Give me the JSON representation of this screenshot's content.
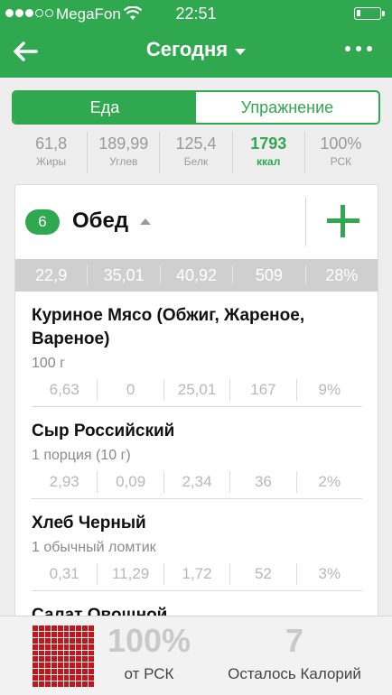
{
  "status": {
    "carrier": "MegaFon",
    "time": "22:51",
    "signal_bars_filled": 3,
    "signal_bars_total": 5
  },
  "nav": {
    "title": "Сегодня"
  },
  "tabs": [
    {
      "label": "Еда",
      "active": true
    },
    {
      "label": "Упражнение",
      "active": false
    }
  ],
  "summary": [
    {
      "value": "61,8",
      "label": "Жиры"
    },
    {
      "value": "189,99",
      "label": "Углев"
    },
    {
      "value": "125,4",
      "label": "Белк"
    },
    {
      "value": "1793",
      "label": "ккал",
      "highlight": true
    },
    {
      "value": "100%",
      "label": "РСК"
    }
  ],
  "meal": {
    "badge": "6",
    "title": "Обед",
    "totals": [
      "22,9",
      "35,01",
      "40,92",
      "509",
      "28%"
    ],
    "foods": [
      {
        "name": "Куриное Мясо (Обжиг, Жареное, Вареное)",
        "portion": "100 г",
        "values": [
          "6,63",
          "0",
          "25,01",
          "167",
          "9%"
        ]
      },
      {
        "name": "Сыр Российский",
        "portion": "1 порция (10 г)",
        "values": [
          "2,93",
          "0,09",
          "2,34",
          "36",
          "2%"
        ]
      },
      {
        "name": "Хлеб Черный",
        "portion": "1 обычный ломтик",
        "values": [
          "0,31",
          "11,29",
          "1,72",
          "52",
          "3%"
        ]
      },
      {
        "name": "Салат Овощной",
        "portion": "",
        "values": []
      }
    ]
  },
  "footer": {
    "percent": "100%",
    "percent_label": "от РСК",
    "remaining": "7",
    "remaining_label": "Осталось Калорий",
    "progress_fraction": 1.0
  },
  "colors": {
    "brand": "#2fa84f",
    "progress": "#c0161c",
    "muted": "#9a9a9a"
  }
}
